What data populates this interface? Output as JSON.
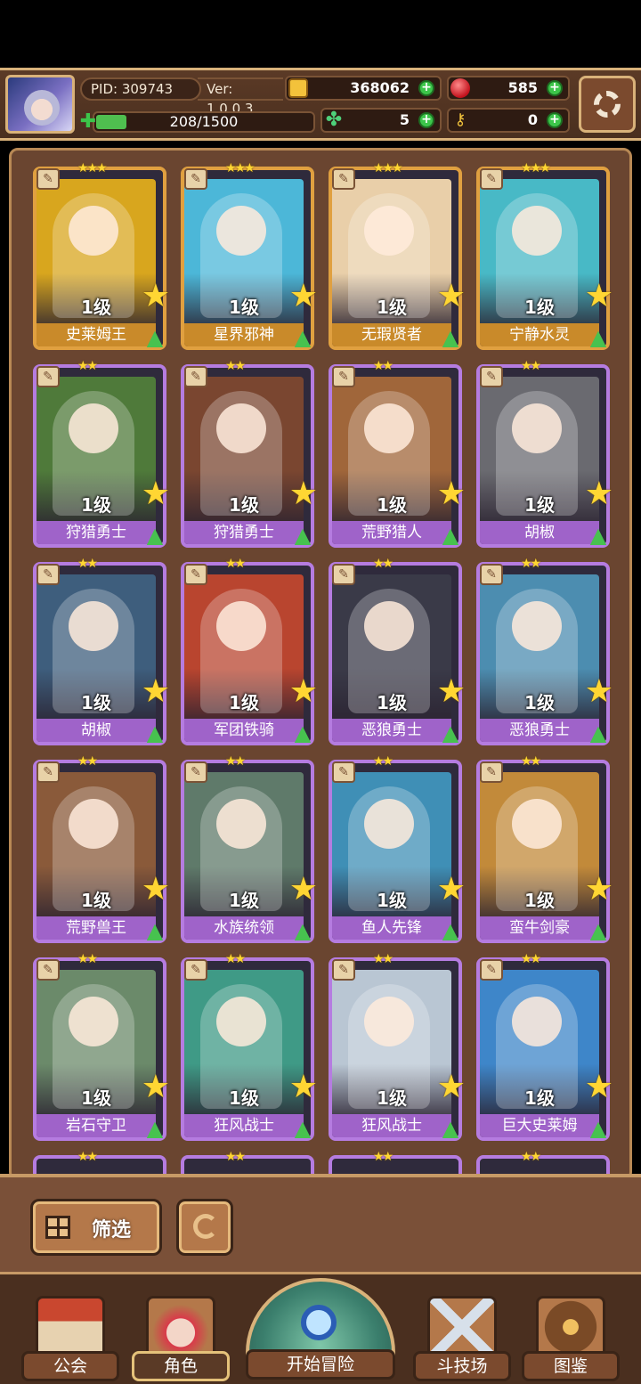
{
  "header": {
    "pid": "PID: 309743",
    "version": "Ver: 1.0.0.3",
    "coins": "368062",
    "gems": "585",
    "energy": "208/1500",
    "energy_fraction": 0.139,
    "clovers": "5",
    "keys": "0"
  },
  "cards": [
    {
      "level": "1级",
      "name": "史莱姆王",
      "rarity": "gold",
      "stars": "★★★",
      "art": "#d8a61e"
    },
    {
      "level": "1级",
      "name": "星界邪神",
      "rarity": "gold",
      "stars": "★★★",
      "art": "#4cb7d8"
    },
    {
      "level": "1级",
      "name": "无瑕贤者",
      "rarity": "gold",
      "stars": "★★★",
      "art": "#e9cfa9"
    },
    {
      "level": "1级",
      "name": "宁静水灵",
      "rarity": "gold",
      "stars": "★★★",
      "art": "#48b9c6"
    },
    {
      "level": "1级",
      "name": "狩猎勇士",
      "rarity": "purple",
      "stars": "★★",
      "art": "#4f7a3a"
    },
    {
      "level": "1级",
      "name": "狩猎勇士",
      "rarity": "purple",
      "stars": "★★",
      "art": "#7a4630"
    },
    {
      "level": "1级",
      "name": "荒野猎人",
      "rarity": "purple",
      "stars": "★★",
      "art": "#a0663a"
    },
    {
      "level": "1级",
      "name": "胡椒",
      "rarity": "purple",
      "stars": "★★",
      "art": "#6a6a70"
    },
    {
      "level": "1级",
      "name": "胡椒",
      "rarity": "purple",
      "stars": "★★",
      "art": "#3e5e7d"
    },
    {
      "level": "1级",
      "name": "军团铁骑",
      "rarity": "purple",
      "stars": "★★",
      "art": "#b9452f"
    },
    {
      "level": "1级",
      "name": "恶狼勇士",
      "rarity": "purple",
      "stars": "★★",
      "art": "#3a3a48"
    },
    {
      "level": "1级",
      "name": "恶狼勇士",
      "rarity": "purple",
      "stars": "★★",
      "art": "#4c8db0"
    },
    {
      "level": "1级",
      "name": "荒野兽王",
      "rarity": "purple",
      "stars": "★★",
      "art": "#8a5a3a"
    },
    {
      "level": "1级",
      "name": "水族统领",
      "rarity": "purple",
      "stars": "★★",
      "art": "#5f7a6a"
    },
    {
      "level": "1级",
      "name": "鱼人先锋",
      "rarity": "purple",
      "stars": "★★",
      "art": "#3f8fb6"
    },
    {
      "level": "1级",
      "name": "蛮牛剑豪",
      "rarity": "purple",
      "stars": "★★",
      "art": "#c28a3a"
    },
    {
      "level": "1级",
      "name": "岩石守卫",
      "rarity": "purple",
      "stars": "★★",
      "art": "#6b8a6a"
    },
    {
      "level": "1级",
      "name": "狂风战士",
      "rarity": "purple",
      "stars": "★★",
      "art": "#3f9a86"
    },
    {
      "level": "1级",
      "name": "狂风战士",
      "rarity": "purple",
      "stars": "★★",
      "art": "#b9c6d3"
    },
    {
      "level": "1级",
      "name": "巨大史莱姆",
      "rarity": "purple",
      "stars": "★★",
      "art": "#3e86c9"
    }
  ],
  "partial_cards_visible": 4,
  "controls": {
    "filter_label": "筛选"
  },
  "nav": {
    "guild": "公会",
    "characters": "角色",
    "adventure": "开始冒险",
    "arena": "斗技场",
    "codex": "图鉴"
  },
  "colors": {
    "gold_frame": "#e0a040",
    "purple_frame": "#b57ce0",
    "panel_bg": "#6a4530"
  }
}
